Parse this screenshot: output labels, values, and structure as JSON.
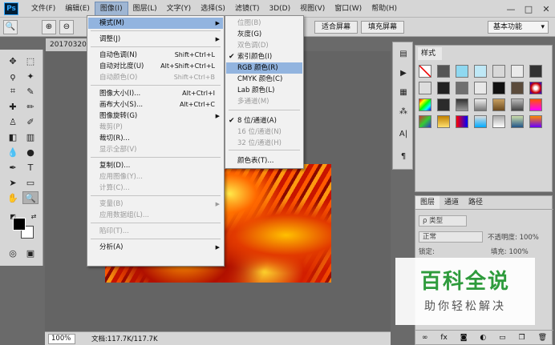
{
  "app": {
    "logo": "Ps"
  },
  "menubar": {
    "items": [
      "文件(F)",
      "编辑(E)",
      "图像(I)",
      "图层(L)",
      "文字(Y)",
      "选择(S)",
      "滤镜(T)",
      "3D(D)",
      "视图(V)",
      "窗口(W)",
      "帮助(H)"
    ]
  },
  "window_controls": {
    "minimize": "—",
    "maximize": "□",
    "close": "✕"
  },
  "options_bar": {
    "fit_screen": "适合屏幕",
    "fill_screen": "填充屏幕",
    "workspace": "基本功能"
  },
  "document": {
    "tab_label": "20170320"
  },
  "status_bar": {
    "zoom": "100%",
    "doc_size": "文档:117.7K/117.7K"
  },
  "image_menu": {
    "items": [
      {
        "label": "模式(M)",
        "shortcut": "",
        "submenu": true,
        "enabled": true,
        "highlight": true
      },
      {
        "label": "调整(J)",
        "shortcut": "",
        "submenu": true,
        "enabled": true
      },
      {
        "label": "自动色调(N)",
        "shortcut": "Shift+Ctrl+L",
        "enabled": true
      },
      {
        "label": "自动对比度(U)",
        "shortcut": "Alt+Shift+Ctrl+L",
        "enabled": true
      },
      {
        "label": "自动颜色(O)",
        "shortcut": "Shift+Ctrl+B",
        "enabled": false
      },
      {
        "label": "图像大小(I)...",
        "shortcut": "Alt+Ctrl+I",
        "enabled": true
      },
      {
        "label": "画布大小(S)...",
        "shortcut": "Alt+Ctrl+C",
        "enabled": true
      },
      {
        "label": "图像旋转(G)",
        "shortcut": "",
        "submenu": true,
        "enabled": true
      },
      {
        "label": "裁剪(P)",
        "shortcut": "",
        "enabled": false
      },
      {
        "label": "裁切(R)...",
        "shortcut": "",
        "enabled": true
      },
      {
        "label": "显示全部(V)",
        "shortcut": "",
        "enabled": false
      },
      {
        "label": "复制(D)...",
        "shortcut": "",
        "enabled": true
      },
      {
        "label": "应用图像(Y)...",
        "shortcut": "",
        "enabled": false
      },
      {
        "label": "计算(C)...",
        "shortcut": "",
        "enabled": false
      },
      {
        "label": "变量(B)",
        "shortcut": "",
        "submenu": true,
        "enabled": false
      },
      {
        "label": "应用数据组(L)...",
        "shortcut": "",
        "enabled": false
      },
      {
        "label": "陷印(T)...",
        "shortcut": "",
        "enabled": false
      },
      {
        "label": "分析(A)",
        "shortcut": "",
        "submenu": true,
        "enabled": true
      }
    ]
  },
  "mode_submenu": {
    "items": [
      {
        "label": "位图(B)",
        "enabled": false,
        "checked": false
      },
      {
        "label": "灰度(G)",
        "enabled": true,
        "checked": false
      },
      {
        "label": "双色调(D)",
        "enabled": false,
        "checked": false
      },
      {
        "label": "索引颜色(I)",
        "enabled": true,
        "checked": true
      },
      {
        "label": "RGB 颜色(R)",
        "enabled": true,
        "checked": false,
        "highlight": true
      },
      {
        "label": "CMYK 颜色(C)",
        "enabled": true,
        "checked": false
      },
      {
        "label": "Lab 颜色(L)",
        "enabled": true,
        "checked": false
      },
      {
        "label": "多通道(M)",
        "enabled": false,
        "checked": false
      },
      {
        "label": "8 位/通道(A)",
        "enabled": true,
        "checked": true
      },
      {
        "label": "16 位/通道(N)",
        "enabled": false,
        "checked": false
      },
      {
        "label": "32 位/通道(H)",
        "enabled": false,
        "checked": false
      },
      {
        "label": "颜色表(T)...",
        "enabled": true,
        "checked": false
      }
    ]
  },
  "styles_panel": {
    "tab": "样式"
  },
  "layers_panel": {
    "tabs": [
      "图层",
      "通道",
      "路径"
    ],
    "filter_label": "ρ 类型",
    "blend_mode": "正常",
    "opacity_label": "不透明度: 100%",
    "lock_label": "锁定:",
    "fill_label": "填充: 100%"
  },
  "watermark": {
    "title": "百科全说",
    "subtitle": "助你轻松解决"
  },
  "colors": {
    "highlight": "#92b4df",
    "menubar": "#d6d6d6",
    "canvas_bg": "#646464",
    "watermark_green": "#2e9b3c"
  }
}
